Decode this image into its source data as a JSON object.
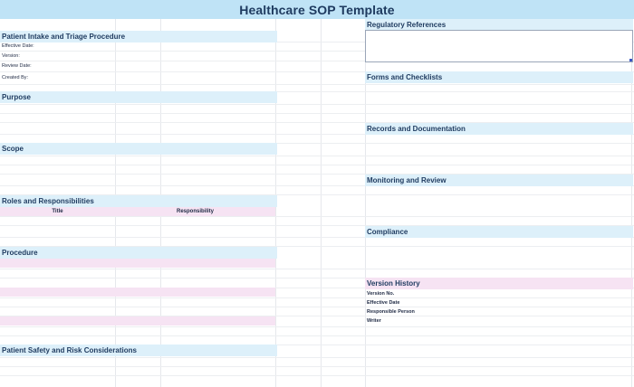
{
  "title": "Healthcare SOP Template",
  "left": {
    "procedure_name": "Patient Intake and Triage Procedure",
    "meta_fields": [
      {
        "label": "Effective Date:"
      },
      {
        "label": "Version:"
      },
      {
        "label": "Review Date:"
      },
      {
        "label": "Created By:"
      }
    ],
    "purpose": "Purpose",
    "scope": "Scope",
    "roles": {
      "heading": "Roles and Responsibilities",
      "columns": [
        "Title",
        "Responsibility"
      ]
    },
    "procedure": "Procedure",
    "safety": "Patient Safety and Risk Considerations"
  },
  "right": {
    "regulatory": "Regulatory References",
    "forms": "Forms and Checklists",
    "records": "Records and Documentation",
    "monitoring": "Monitoring and Review",
    "compliance": "Compliance",
    "version_history": {
      "heading": "Version History",
      "fields": [
        "Version No.",
        "Effective Date",
        "Responsible Person",
        "Writer"
      ]
    }
  },
  "colors": {
    "banner": "#bfe3f6",
    "section": "#ddf0fa",
    "pink_band": "#f6e3f3",
    "text": "#1e3a5f"
  }
}
